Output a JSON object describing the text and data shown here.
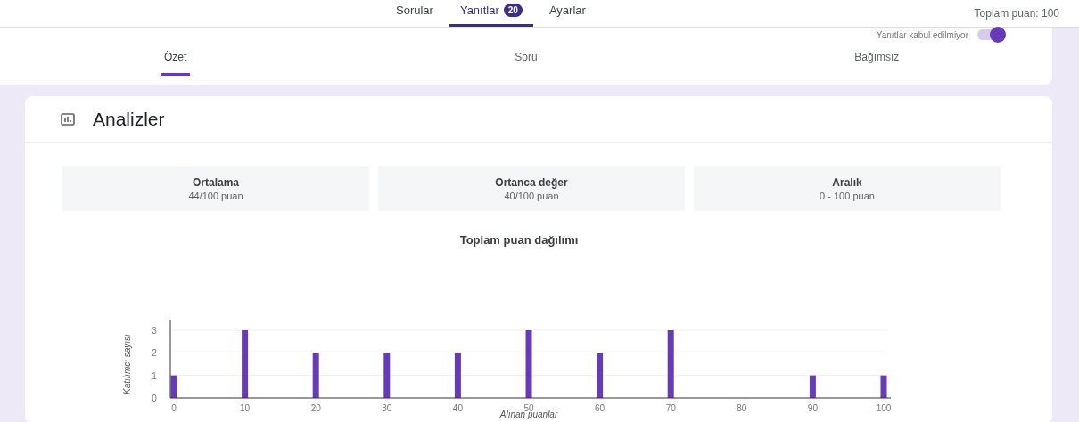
{
  "top_tabs": [
    {
      "label": "Sorular",
      "selected": false
    },
    {
      "label": "Yanıtlar",
      "selected": true,
      "badge": "20"
    },
    {
      "label": "Ayarlar",
      "selected": false
    }
  ],
  "total_points": "Toplam puan: 100",
  "accepting": {
    "label": "Yanıtlar kabul edilmiyor",
    "on": true
  },
  "summary_tabs": [
    {
      "label": "Özet",
      "selected": true
    },
    {
      "label": "Soru",
      "selected": false
    },
    {
      "label": "Bağımsız",
      "selected": false
    }
  ],
  "analytics": {
    "title": "Analizler",
    "stats": [
      {
        "label": "Ortalama",
        "value": "44/100 puan"
      },
      {
        "label": "Ortanca değer",
        "value": "40/100 puan"
      },
      {
        "label": "Aralık",
        "value": "0 - 100 puan"
      }
    ],
    "chart_data": {
      "type": "bar",
      "title": "Toplam puan dağılımı",
      "xlabel": "Alınan puanlar",
      "ylabel": "Katılımcı sayısı",
      "categories": [
        "0",
        "10",
        "20",
        "30",
        "40",
        "50",
        "60",
        "70",
        "80",
        "90",
        "100"
      ],
      "values": [
        1,
        3,
        2,
        2,
        2,
        3,
        2,
        3,
        0,
        1,
        1
      ],
      "ylim": [
        0,
        3
      ],
      "yticks": [
        0,
        1,
        2,
        3
      ]
    }
  }
}
